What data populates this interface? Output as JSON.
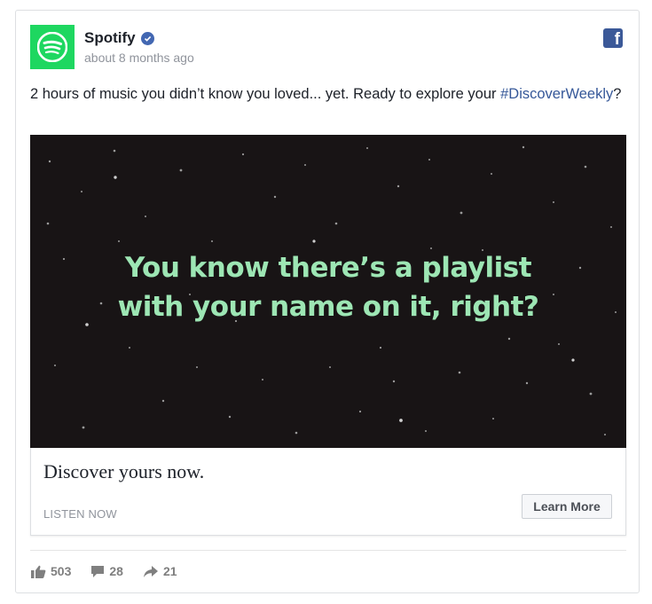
{
  "post": {
    "page_name": "Spotify",
    "timestamp": "about 8 months ago",
    "caption_text": "2 hours of music you didn’t know you loved... yet. Ready to explore your ",
    "caption_hashtag": "#DiscoverWeekly",
    "caption_end": "?"
  },
  "media": {
    "headline_line1": "You know there’s a playlist",
    "headline_line2": "with your name on it, right?"
  },
  "link": {
    "title": "Discover yours now.",
    "source": "LISTEN NOW",
    "cta_label": "Learn More"
  },
  "engagement": {
    "likes": "503",
    "comments": "28",
    "shares": "21"
  },
  "colors": {
    "brand_green": "#1ed760",
    "headline_green": "#9de6b4",
    "media_background": "#181415",
    "facebook_blue": "#3b5998",
    "link_blue": "#365899"
  },
  "icons": [
    "spotify-logo-icon",
    "verified-badge-icon",
    "facebook-logo-icon",
    "like-icon",
    "comment-icon",
    "share-icon"
  ]
}
